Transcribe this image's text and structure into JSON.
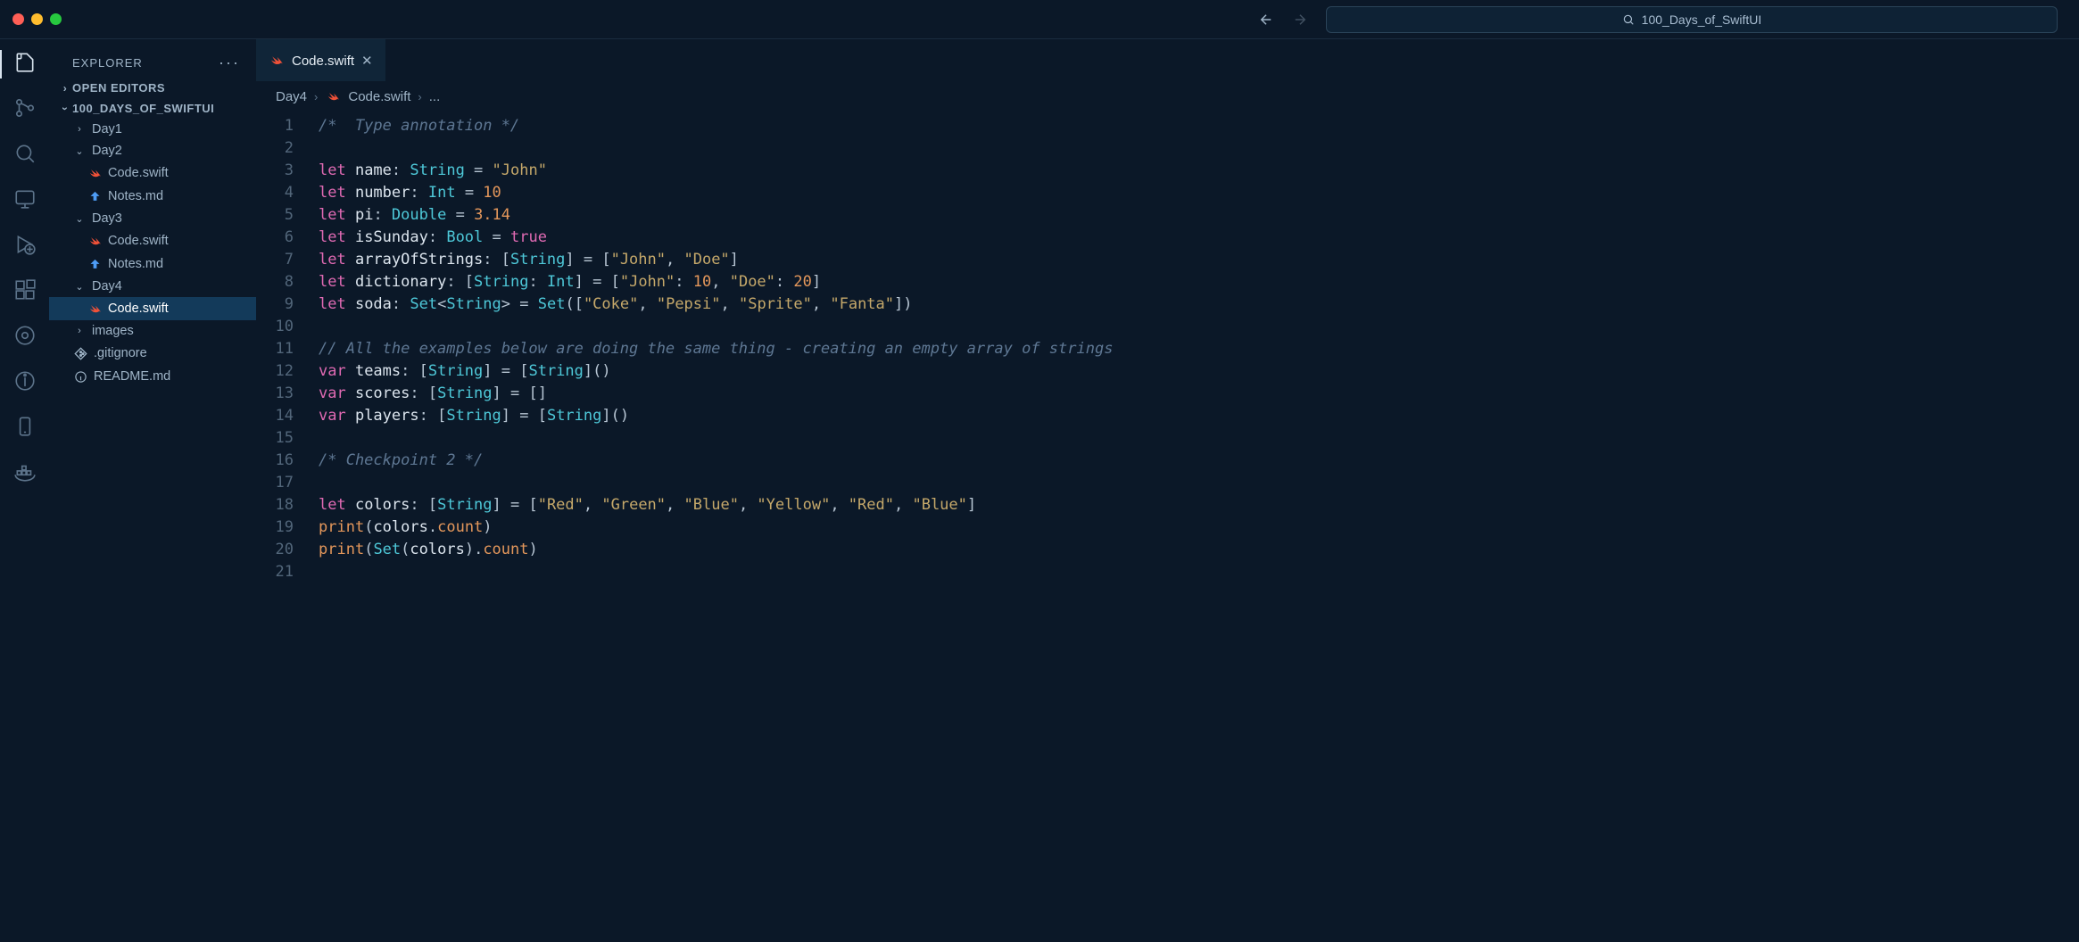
{
  "titlebar": {
    "project_name": "100_Days_of_SwiftUI"
  },
  "sidebar": {
    "title": "EXPLORER",
    "sections": {
      "open_editors": "OPEN EDITORS",
      "project": "100_DAYS_OF_SWIFTUI"
    },
    "tree": [
      {
        "name": "Day1",
        "kind": "folder",
        "expanded": false,
        "depth": 1
      },
      {
        "name": "Day2",
        "kind": "folder",
        "expanded": true,
        "depth": 1
      },
      {
        "name": "Code.swift",
        "kind": "swift",
        "depth": 2
      },
      {
        "name": "Notes.md",
        "kind": "md",
        "depth": 2
      },
      {
        "name": "Day3",
        "kind": "folder",
        "expanded": true,
        "depth": 1
      },
      {
        "name": "Code.swift",
        "kind": "swift",
        "depth": 2
      },
      {
        "name": "Notes.md",
        "kind": "md",
        "depth": 2
      },
      {
        "name": "Day4",
        "kind": "folder",
        "expanded": true,
        "depth": 1
      },
      {
        "name": "Code.swift",
        "kind": "swift",
        "depth": 2,
        "selected": true
      },
      {
        "name": "images",
        "kind": "folder",
        "expanded": false,
        "depth": 1
      },
      {
        "name": ".gitignore",
        "kind": "git",
        "depth": 1
      },
      {
        "name": "README.md",
        "kind": "info",
        "depth": 1
      }
    ]
  },
  "tab": {
    "filename": "Code.swift"
  },
  "breadcrumbs": {
    "folder": "Day4",
    "file": "Code.swift",
    "more": "..."
  },
  "code": {
    "lines": [
      {
        "n": 1,
        "t": [
          [
            "comment",
            "/*  Type annotation */"
          ]
        ]
      },
      {
        "n": 2,
        "t": [
          [
            "",
            ""
          ]
        ]
      },
      {
        "n": 3,
        "t": [
          [
            "keyword",
            "let"
          ],
          [
            "",
            ", "
          ],
          [
            "ident",
            " name"
          ],
          [
            "punct",
            ": "
          ],
          [
            "type",
            "String"
          ],
          [
            "punct",
            " = "
          ],
          [
            "string",
            "\"John\""
          ]
        ]
      },
      {
        "n": 4,
        "t": [
          [
            "keyword",
            "let"
          ],
          [
            "ident",
            " number"
          ],
          [
            "punct",
            ": "
          ],
          [
            "type",
            "Int"
          ],
          [
            "punct",
            " = "
          ],
          [
            "number",
            "10"
          ]
        ]
      },
      {
        "n": 5,
        "t": [
          [
            "keyword",
            "let"
          ],
          [
            "ident",
            " pi"
          ],
          [
            "punct",
            ": "
          ],
          [
            "type",
            "Double"
          ],
          [
            "punct",
            " = "
          ],
          [
            "number",
            "3.14"
          ]
        ]
      },
      {
        "n": 6,
        "t": [
          [
            "keyword",
            "let"
          ],
          [
            "ident",
            " isSunday"
          ],
          [
            "punct",
            ": "
          ],
          [
            "type",
            "Bool"
          ],
          [
            "punct",
            " = "
          ],
          [
            "bool",
            "true"
          ]
        ]
      },
      {
        "n": 7,
        "t": [
          [
            "keyword",
            "let"
          ],
          [
            "ident",
            " arrayOfStrings"
          ],
          [
            "punct",
            ": ["
          ],
          [
            "type",
            "String"
          ],
          [
            "punct",
            "] = ["
          ],
          [
            "string",
            "\"John\""
          ],
          [
            "punct",
            ", "
          ],
          [
            "string",
            "\"Doe\""
          ],
          [
            "punct",
            "]"
          ]
        ]
      },
      {
        "n": 8,
        "t": [
          [
            "keyword",
            "let"
          ],
          [
            "ident",
            " dictionary"
          ],
          [
            "punct",
            ": ["
          ],
          [
            "type",
            "String"
          ],
          [
            "punct",
            ": "
          ],
          [
            "type",
            "Int"
          ],
          [
            "punct",
            "] = ["
          ],
          [
            "string",
            "\"John\""
          ],
          [
            "punct",
            ": "
          ],
          [
            "number",
            "10"
          ],
          [
            "punct",
            ", "
          ],
          [
            "string",
            "\"Doe\""
          ],
          [
            "punct",
            ": "
          ],
          [
            "number",
            "20"
          ],
          [
            "punct",
            "]"
          ]
        ]
      },
      {
        "n": 9,
        "t": [
          [
            "keyword",
            "let"
          ],
          [
            "ident",
            " soda"
          ],
          [
            "punct",
            ": "
          ],
          [
            "type",
            "Set"
          ],
          [
            "punct",
            "<"
          ],
          [
            "type",
            "String"
          ],
          [
            "punct",
            "> = "
          ],
          [
            "func2",
            "Set"
          ],
          [
            "punct",
            "(["
          ],
          [
            "string",
            "\"Coke\""
          ],
          [
            "punct",
            ", "
          ],
          [
            "string",
            "\"Pepsi\""
          ],
          [
            "punct",
            ", "
          ],
          [
            "string",
            "\"Sprite\""
          ],
          [
            "punct",
            ", "
          ],
          [
            "string",
            "\"Fanta\""
          ],
          [
            "punct",
            "])"
          ]
        ]
      },
      {
        "n": 10,
        "t": [
          [
            "",
            ""
          ]
        ]
      },
      {
        "n": 11,
        "t": [
          [
            "comment",
            "// All the examples below are doing the same thing - creating an empty array of strings"
          ]
        ]
      },
      {
        "n": 12,
        "t": [
          [
            "keyword",
            "var"
          ],
          [
            "ident",
            " teams"
          ],
          [
            "punct",
            ": ["
          ],
          [
            "type",
            "String"
          ],
          [
            "punct",
            "] = ["
          ],
          [
            "type",
            "String"
          ],
          [
            "punct",
            "]()"
          ]
        ]
      },
      {
        "n": 13,
        "t": [
          [
            "keyword",
            "var"
          ],
          [
            "ident",
            " scores"
          ],
          [
            "punct",
            ": ["
          ],
          [
            "type",
            "String"
          ],
          [
            "punct",
            "] = []"
          ]
        ]
      },
      {
        "n": 14,
        "t": [
          [
            "keyword",
            "var"
          ],
          [
            "ident",
            " players"
          ],
          [
            "var",
            ": "
          ],
          [
            "punct",
            "["
          ],
          [
            "type",
            "String"
          ],
          [
            "punct",
            "] = ["
          ],
          [
            "type",
            "String"
          ],
          [
            "punct",
            "]()"
          ]
        ]
      },
      {
        "n": 15,
        "t": [
          [
            "",
            ""
          ]
        ]
      },
      {
        "n": 16,
        "t": [
          [
            "comment",
            "/* Checkpoint 2 */"
          ]
        ]
      },
      {
        "n": 17,
        "t": [
          [
            "",
            ""
          ]
        ]
      },
      {
        "n": 18,
        "t": [
          [
            "keyword",
            "let"
          ],
          [
            "ident",
            " colors"
          ],
          [
            "punct",
            ": ["
          ],
          [
            "type",
            "String"
          ],
          [
            "punct",
            "] = ["
          ],
          [
            "string",
            "\"Red\""
          ],
          [
            "punct",
            ", "
          ],
          [
            "string",
            "\"Green\""
          ],
          [
            "punct",
            ", "
          ],
          [
            "string",
            "\"Blue\""
          ],
          [
            "punct",
            ", "
          ],
          [
            "string",
            "\"Yellow\""
          ],
          [
            "punct",
            ", "
          ],
          [
            "string",
            "\"Red\""
          ],
          [
            "punct",
            ", "
          ],
          [
            "string",
            "\"Blue\""
          ],
          [
            "punct",
            "]"
          ]
        ]
      },
      {
        "n": 19,
        "t": [
          [
            "func",
            "print"
          ],
          [
            "punct",
            "("
          ],
          [
            "ident",
            "colors"
          ],
          [
            "punct",
            "."
          ],
          [
            "prop",
            "count"
          ],
          [
            "punct",
            ")"
          ]
        ]
      },
      {
        "n": 20,
        "t": [
          [
            "func",
            "print"
          ],
          [
            "punct",
            "("
          ],
          [
            "func2",
            "Set"
          ],
          [
            "punct",
            "("
          ],
          [
            "ident",
            "colors"
          ],
          [
            "punct",
            ")."
          ],
          [
            "prop",
            "count"
          ],
          [
            "punct",
            ")"
          ]
        ]
      },
      {
        "n": 21,
        "t": [
          [
            "",
            ""
          ]
        ]
      }
    ]
  }
}
